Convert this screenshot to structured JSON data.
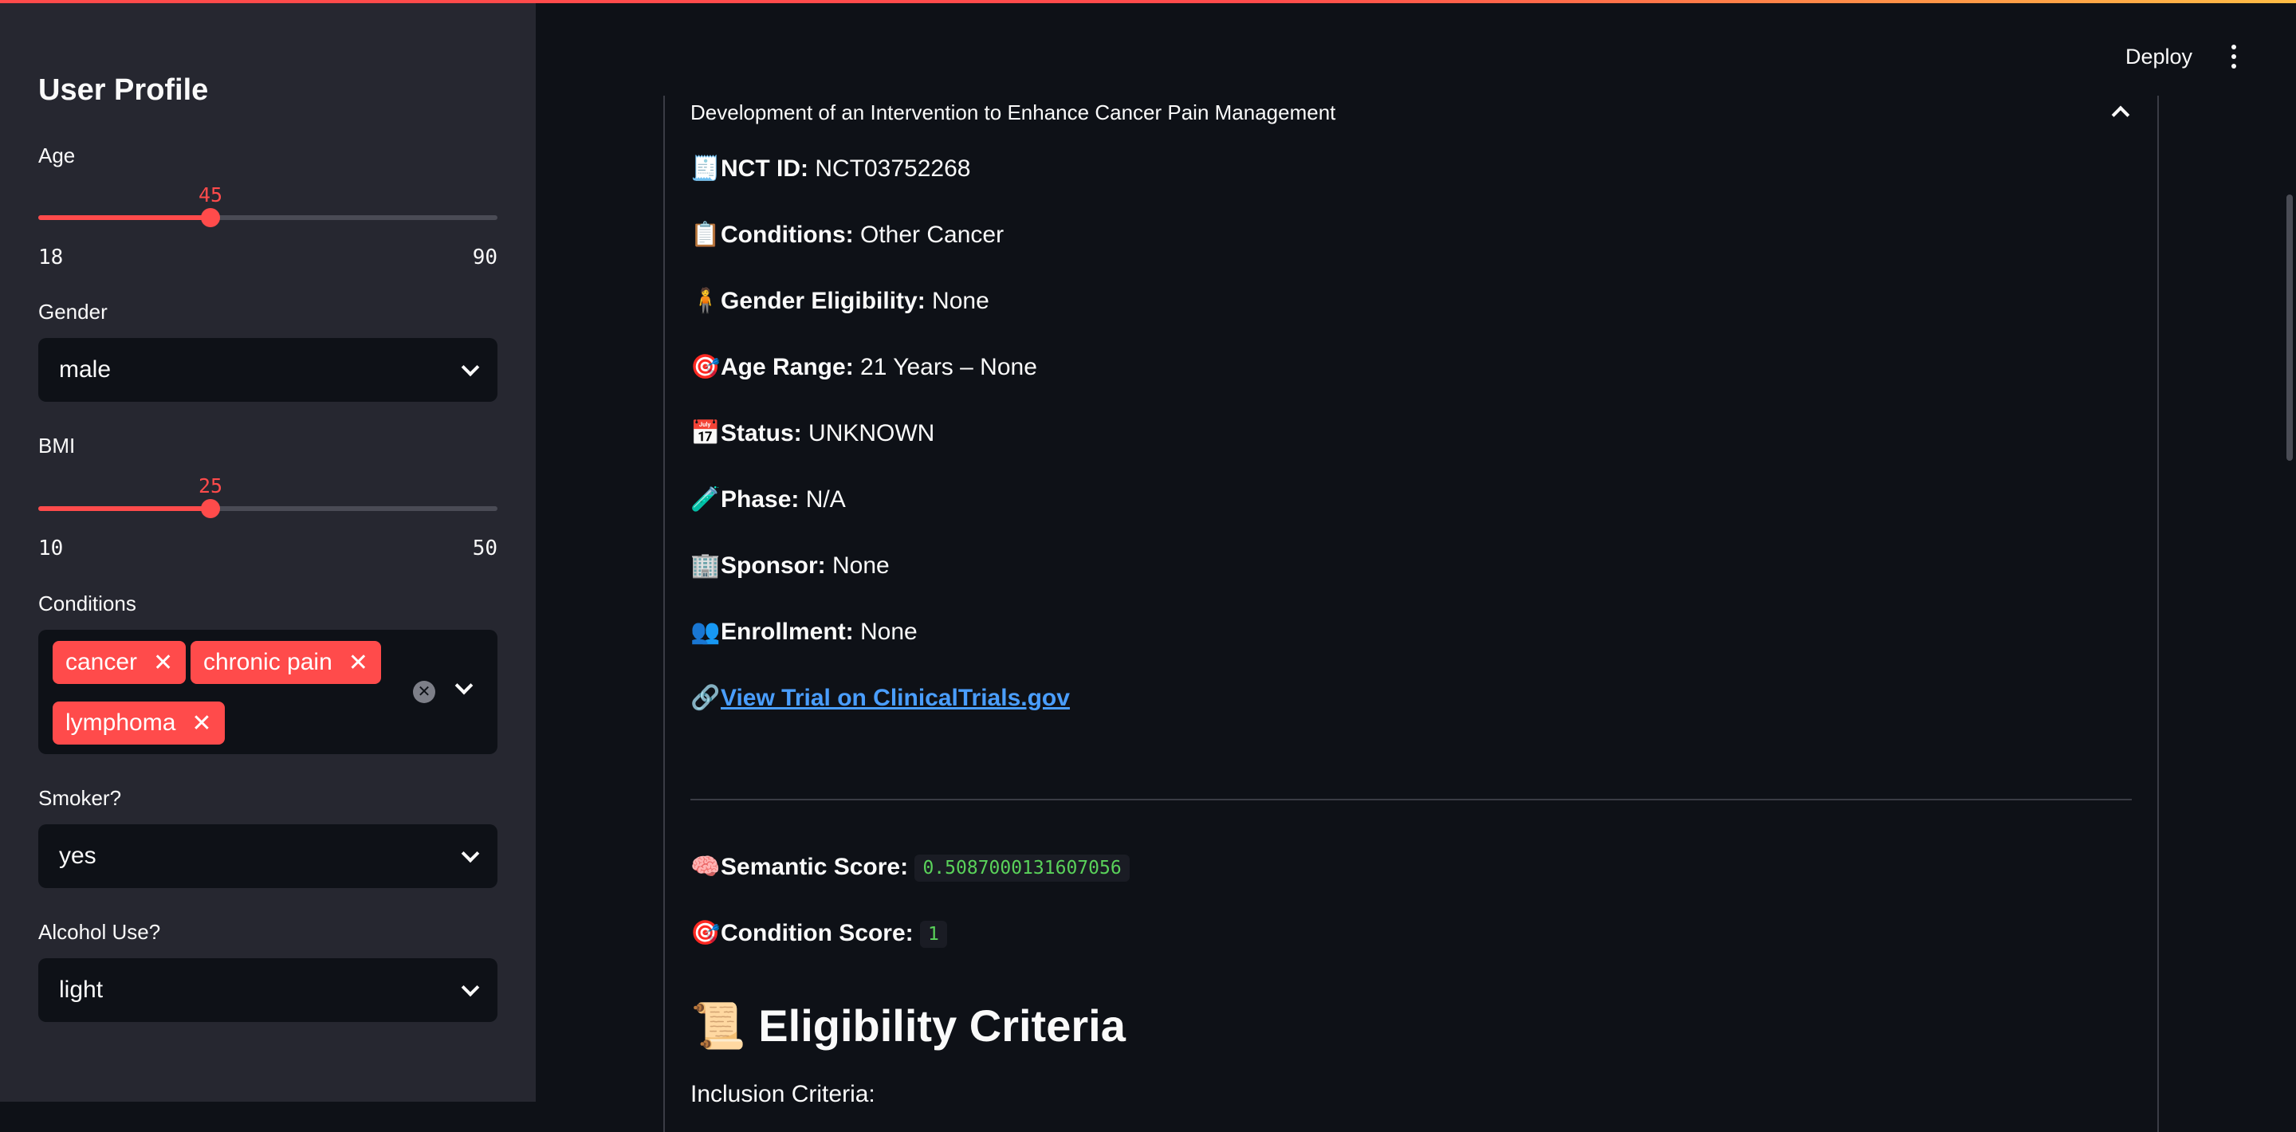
{
  "header": {
    "deploy_label": "Deploy"
  },
  "sidebar": {
    "title": "User Profile",
    "age": {
      "label": "Age",
      "value": "45",
      "min": "18",
      "max": "90",
      "fraction": 0.375
    },
    "gender": {
      "label": "Gender",
      "value": "male"
    },
    "bmi": {
      "label": "BMI",
      "value": "25",
      "min": "10",
      "max": "50",
      "fraction": 0.375
    },
    "conditions": {
      "label": "Conditions",
      "tags": [
        "cancer",
        "chronic pain",
        "lymphoma"
      ]
    },
    "smoker": {
      "label": "Smoker?",
      "value": "yes"
    },
    "alcohol": {
      "label": "Alcohol Use?",
      "value": "light"
    }
  },
  "trial": {
    "title": "Development of an Intervention to Enhance Cancer Pain Management",
    "nct": {
      "icon": "🧾",
      "label": "NCT ID:",
      "value": "NCT03752268"
    },
    "conditions": {
      "icon": "📋",
      "label": "Conditions:",
      "value": "Other Cancer"
    },
    "gender": {
      "icon": "🧍",
      "label": "Gender Eligibility:",
      "value": "None"
    },
    "age": {
      "icon": "🎯",
      "label": "Age Range:",
      "value": "21 Years – None"
    },
    "status": {
      "icon": "📅",
      "label": "Status:",
      "value": "UNKNOWN"
    },
    "phase": {
      "icon": "🧪",
      "label": "Phase:",
      "value": "N/A"
    },
    "sponsor": {
      "icon": "🏢",
      "label": "Sponsor:",
      "value": "None"
    },
    "enrollment": {
      "icon": "👥",
      "label": "Enrollment:",
      "value": "None"
    },
    "link": {
      "icon": "🔗",
      "text": "View Trial on ClinicalTrials.gov"
    },
    "semantic": {
      "icon": "🧠",
      "label": "Semantic Score:",
      "value": "0.5087000131607056"
    },
    "condition_score": {
      "icon": "🎯",
      "label": "Condition Score:",
      "value": "1"
    },
    "eligibility": {
      "icon": "📜",
      "heading": "Eligibility Criteria",
      "sub": "Inclusion Criteria:"
    }
  },
  "colors": {
    "accent": "#ff4b4b",
    "link": "#4a9eff",
    "code": "#5ad25a"
  }
}
